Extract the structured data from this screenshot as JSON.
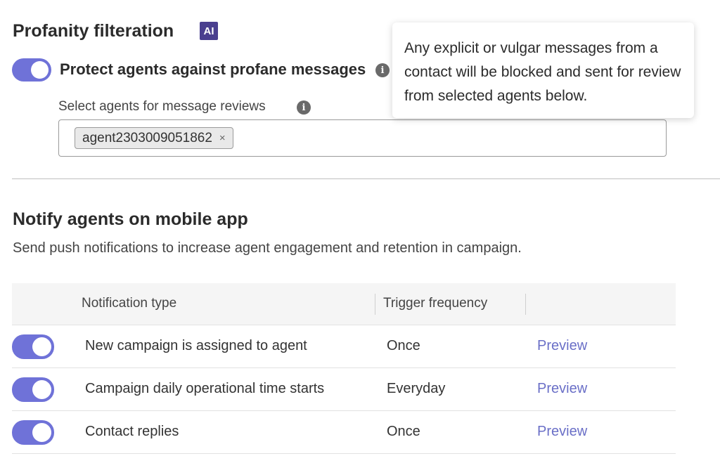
{
  "profanity": {
    "title": "Profanity filteration",
    "ai_badge": "AI",
    "protect_label": "Protect agents against profane messages",
    "protect_enabled": true,
    "select_label": "Select agents for message reviews",
    "selected_agents": [
      "agent2303009051862"
    ],
    "chip_remove": "×",
    "info_icon": "i",
    "tooltip": "Any explicit or vulgar messages from a contact will be blocked and sent for review from selected agents below."
  },
  "notify": {
    "title": "Notify agents on mobile app",
    "description": "Send push notifications to increase agent engagement and retention in campaign.",
    "columns": [
      "Notification type",
      "Trigger frequency"
    ],
    "rows": [
      {
        "type": "New campaign is assigned to agent",
        "frequency": "Once",
        "action": "Preview",
        "enabled": true
      },
      {
        "type": "Campaign daily operational time starts",
        "frequency": "Everyday",
        "action": "Preview",
        "enabled": true
      },
      {
        "type": "Contact replies",
        "frequency": "Once",
        "action": "Preview",
        "enabled": true
      }
    ]
  },
  "colors": {
    "toggle_on": "#6f72d8",
    "link": "#6a6fc7",
    "ai_badge": "#4a3f8f"
  }
}
